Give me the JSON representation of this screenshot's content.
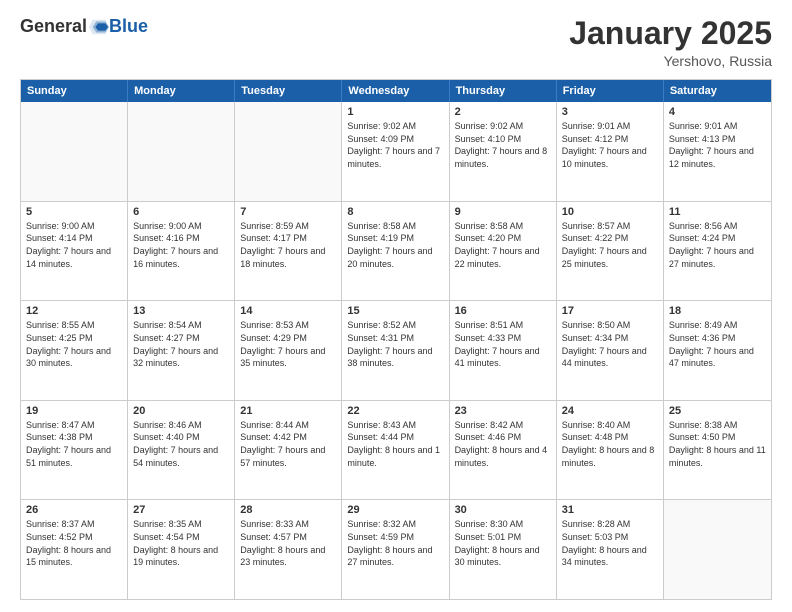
{
  "logo": {
    "general": "General",
    "blue": "Blue"
  },
  "title": {
    "month": "January 2025",
    "location": "Yershovo, Russia"
  },
  "header": {
    "days": [
      "Sunday",
      "Monday",
      "Tuesday",
      "Wednesday",
      "Thursday",
      "Friday",
      "Saturday"
    ]
  },
  "weeks": [
    [
      {
        "day": "",
        "info": ""
      },
      {
        "day": "",
        "info": ""
      },
      {
        "day": "",
        "info": ""
      },
      {
        "day": "1",
        "info": "Sunrise: 9:02 AM\nSunset: 4:09 PM\nDaylight: 7 hours\nand 7 minutes."
      },
      {
        "day": "2",
        "info": "Sunrise: 9:02 AM\nSunset: 4:10 PM\nDaylight: 7 hours\nand 8 minutes."
      },
      {
        "day": "3",
        "info": "Sunrise: 9:01 AM\nSunset: 4:12 PM\nDaylight: 7 hours\nand 10 minutes."
      },
      {
        "day": "4",
        "info": "Sunrise: 9:01 AM\nSunset: 4:13 PM\nDaylight: 7 hours\nand 12 minutes."
      }
    ],
    [
      {
        "day": "5",
        "info": "Sunrise: 9:00 AM\nSunset: 4:14 PM\nDaylight: 7 hours\nand 14 minutes."
      },
      {
        "day": "6",
        "info": "Sunrise: 9:00 AM\nSunset: 4:16 PM\nDaylight: 7 hours\nand 16 minutes."
      },
      {
        "day": "7",
        "info": "Sunrise: 8:59 AM\nSunset: 4:17 PM\nDaylight: 7 hours\nand 18 minutes."
      },
      {
        "day": "8",
        "info": "Sunrise: 8:58 AM\nSunset: 4:19 PM\nDaylight: 7 hours\nand 20 minutes."
      },
      {
        "day": "9",
        "info": "Sunrise: 8:58 AM\nSunset: 4:20 PM\nDaylight: 7 hours\nand 22 minutes."
      },
      {
        "day": "10",
        "info": "Sunrise: 8:57 AM\nSunset: 4:22 PM\nDaylight: 7 hours\nand 25 minutes."
      },
      {
        "day": "11",
        "info": "Sunrise: 8:56 AM\nSunset: 4:24 PM\nDaylight: 7 hours\nand 27 minutes."
      }
    ],
    [
      {
        "day": "12",
        "info": "Sunrise: 8:55 AM\nSunset: 4:25 PM\nDaylight: 7 hours\nand 30 minutes."
      },
      {
        "day": "13",
        "info": "Sunrise: 8:54 AM\nSunset: 4:27 PM\nDaylight: 7 hours\nand 32 minutes."
      },
      {
        "day": "14",
        "info": "Sunrise: 8:53 AM\nSunset: 4:29 PM\nDaylight: 7 hours\nand 35 minutes."
      },
      {
        "day": "15",
        "info": "Sunrise: 8:52 AM\nSunset: 4:31 PM\nDaylight: 7 hours\nand 38 minutes."
      },
      {
        "day": "16",
        "info": "Sunrise: 8:51 AM\nSunset: 4:33 PM\nDaylight: 7 hours\nand 41 minutes."
      },
      {
        "day": "17",
        "info": "Sunrise: 8:50 AM\nSunset: 4:34 PM\nDaylight: 7 hours\nand 44 minutes."
      },
      {
        "day": "18",
        "info": "Sunrise: 8:49 AM\nSunset: 4:36 PM\nDaylight: 7 hours\nand 47 minutes."
      }
    ],
    [
      {
        "day": "19",
        "info": "Sunrise: 8:47 AM\nSunset: 4:38 PM\nDaylight: 7 hours\nand 51 minutes."
      },
      {
        "day": "20",
        "info": "Sunrise: 8:46 AM\nSunset: 4:40 PM\nDaylight: 7 hours\nand 54 minutes."
      },
      {
        "day": "21",
        "info": "Sunrise: 8:44 AM\nSunset: 4:42 PM\nDaylight: 7 hours\nand 57 minutes."
      },
      {
        "day": "22",
        "info": "Sunrise: 8:43 AM\nSunset: 4:44 PM\nDaylight: 8 hours\nand 1 minute."
      },
      {
        "day": "23",
        "info": "Sunrise: 8:42 AM\nSunset: 4:46 PM\nDaylight: 8 hours\nand 4 minutes."
      },
      {
        "day": "24",
        "info": "Sunrise: 8:40 AM\nSunset: 4:48 PM\nDaylight: 8 hours\nand 8 minutes."
      },
      {
        "day": "25",
        "info": "Sunrise: 8:38 AM\nSunset: 4:50 PM\nDaylight: 8 hours\nand 11 minutes."
      }
    ],
    [
      {
        "day": "26",
        "info": "Sunrise: 8:37 AM\nSunset: 4:52 PM\nDaylight: 8 hours\nand 15 minutes."
      },
      {
        "day": "27",
        "info": "Sunrise: 8:35 AM\nSunset: 4:54 PM\nDaylight: 8 hours\nand 19 minutes."
      },
      {
        "day": "28",
        "info": "Sunrise: 8:33 AM\nSunset: 4:57 PM\nDaylight: 8 hours\nand 23 minutes."
      },
      {
        "day": "29",
        "info": "Sunrise: 8:32 AM\nSunset: 4:59 PM\nDaylight: 8 hours\nand 27 minutes."
      },
      {
        "day": "30",
        "info": "Sunrise: 8:30 AM\nSunset: 5:01 PM\nDaylight: 8 hours\nand 30 minutes."
      },
      {
        "day": "31",
        "info": "Sunrise: 8:28 AM\nSunset: 5:03 PM\nDaylight: 8 hours\nand 34 minutes."
      },
      {
        "day": "",
        "info": ""
      }
    ]
  ]
}
